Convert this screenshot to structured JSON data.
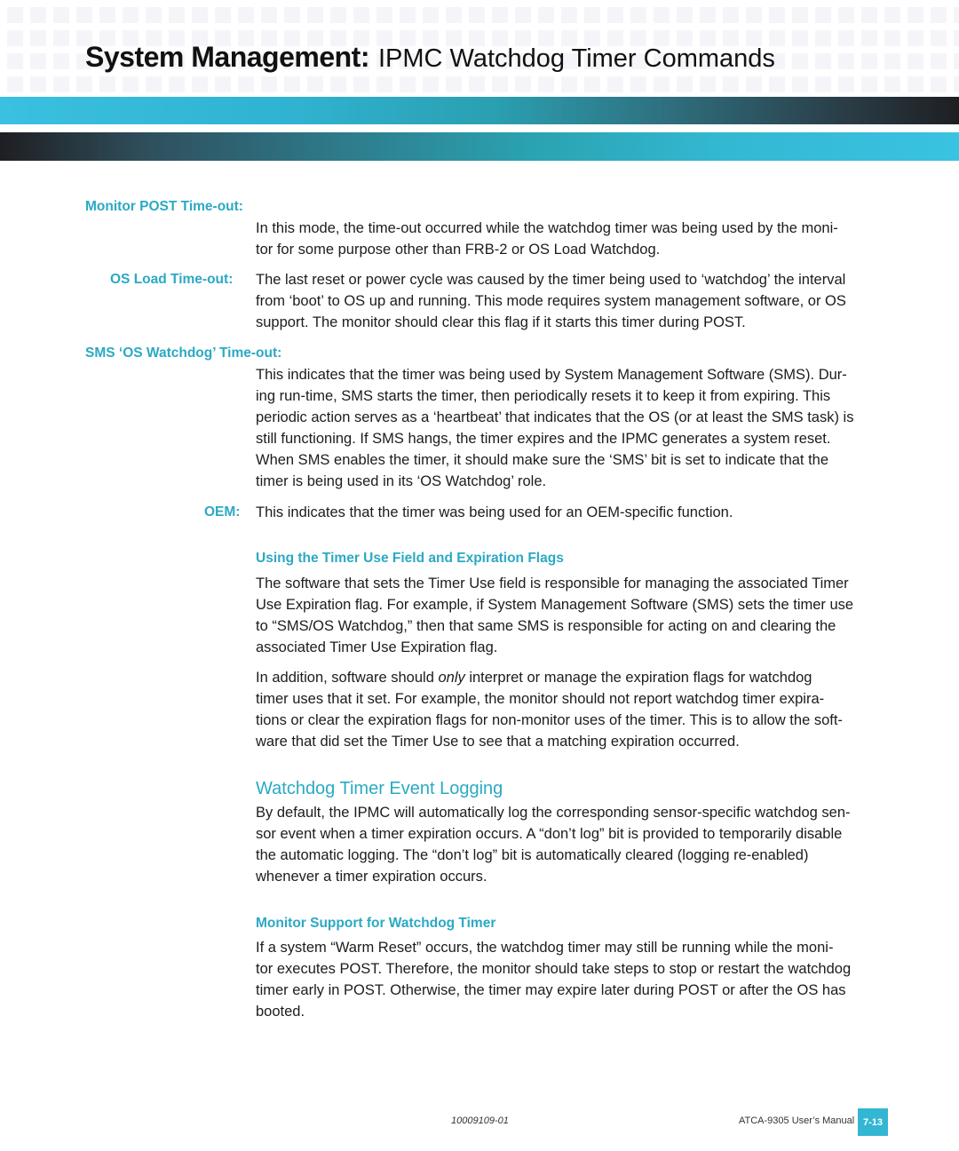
{
  "header": {
    "title_strong": "System Management:",
    "title_light": "IPMC Watchdog Timer Commands"
  },
  "definitions": [
    {
      "label": "Monitor POST Time-out:",
      "lines": [
        "In this mode, the time-out occurred while the watchdog timer was being used by the moni-",
        "tor for some purpose other than FRB-2 or OS Load Watchdog."
      ]
    },
    {
      "label": "OS Load Time-out:",
      "lines": [
        "The last reset or power cycle was caused by the timer being used to ‘watchdog’ the interval",
        "from ‘boot’ to OS up and running. This mode requires system management software, or OS",
        "support. The monitor should clear this flag if it starts this timer during POST."
      ]
    },
    {
      "label": "SMS ‘OS Watchdog’ Time-out:",
      "lines": [
        "This indicates that the timer was being used by System Management Software (SMS). Dur-",
        "ing run-time, SMS starts the timer, then periodically resets it to keep it from expiring. This",
        "periodic action serves as a ‘heartbeat’ that indicates that the OS (or at least the SMS task) is",
        "still functioning. If SMS hangs, the timer expires and the IPMC generates a system reset.",
        "When SMS enables the timer, it should make sure the ‘SMS’ bit is set to indicate that the",
        "timer is being used in its ‘OS Watchdog’ role."
      ]
    },
    {
      "label": "OEM:",
      "lines": [
        "This indicates that the timer was being used for an OEM-specific function."
      ]
    }
  ],
  "section_timer_use": {
    "heading": "Using the Timer Use Field and Expiration Flags",
    "para1": [
      "The software that sets the Timer Use field is responsible for managing the associated Timer",
      "Use Expiration flag. For example, if System Management Software (SMS) sets the timer use",
      "to “SMS/OS Watchdog,” then that same SMS is responsible for acting on and clearing the",
      "associated Timer Use Expiration flag."
    ],
    "para2_line1_pre": "In addition, software should ",
    "para2_line1_em": "only",
    "para2_line1_post": " interpret or manage the expiration flags for watchdog",
    "para2": [
      "timer uses that it set. For example, the monitor should not report watchdog timer expira-",
      "tions or clear the expiration flags for non-monitor uses of the timer. This is to allow the soft-",
      "ware that did set the Timer Use to see that a matching expiration occurred."
    ]
  },
  "section_event_logging": {
    "heading": "Watchdog Timer Event Logging",
    "lines": [
      "By default, the IPMC will automatically log the corresponding sensor-specific watchdog sen-",
      "sor event when a timer expiration occurs. A “don’t log” bit is provided to temporarily disable",
      "the automatic logging. The “don’t log” bit is automatically cleared (logging re-enabled)",
      "whenever a timer expiration occurs."
    ]
  },
  "section_monitor_support": {
    "heading": "Monitor Support for Watchdog Timer",
    "lines": [
      "If a system “Warm Reset” occurs, the watchdog timer may still be running while the moni-",
      "tor executes POST. Therefore, the monitor should take steps to stop or restart the watchdog",
      "timer early in POST. Otherwise, the timer may expire later during POST or after the OS has",
      "booted."
    ]
  },
  "footer": {
    "doc_number": "10009109-01",
    "manual_name": "ATCA-9305 User’s Manual",
    "page_number": "7-13"
  },
  "colors": {
    "accent": "#2ba9c4",
    "page_badge": "#33b6d2"
  }
}
